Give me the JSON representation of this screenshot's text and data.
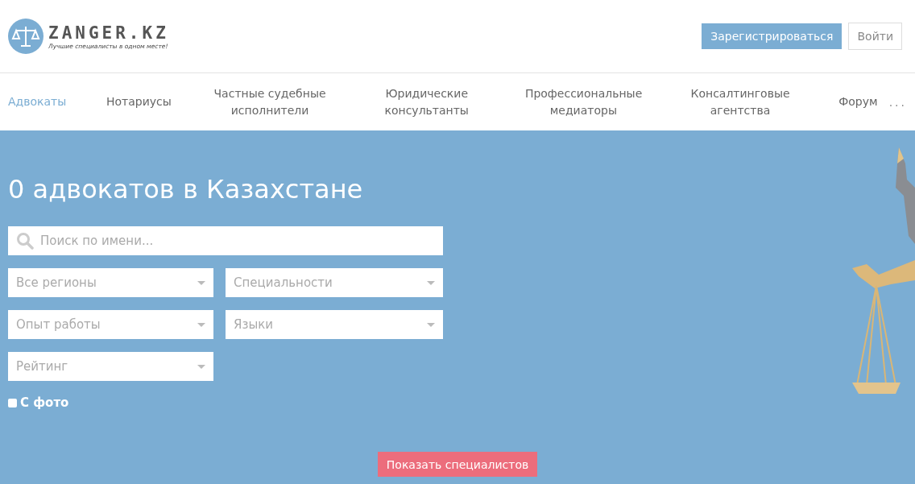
{
  "header": {
    "logo": {
      "name": "ZANGER.KZ",
      "tagline": "Лучшие специалисты в одном месте!"
    },
    "buttons": [
      {
        "label": "Зарегистрироваться",
        "kind": "primary"
      },
      {
        "label": "Войти",
        "kind": "outline"
      }
    ]
  },
  "nav": {
    "items": [
      {
        "label": "Адвокаты",
        "selected": true
      },
      {
        "label": "Нотариусы",
        "selected": false
      },
      {
        "label": "Частные судебные исполнители",
        "selected": false
      },
      {
        "label": "Юридические консультанты",
        "selected": false
      },
      {
        "label": "Профессиональные медиаторы",
        "selected": false
      },
      {
        "label": "Консалтинговые агентства",
        "selected": false
      },
      {
        "label": "Форум",
        "selected": false
      }
    ],
    "more": "..."
  },
  "hero": {
    "title": "0 адвокатов в Казахстане",
    "search": {
      "placeholder": "Поиск по имени..."
    },
    "filters": [
      {
        "placeholder": "Все регионы"
      },
      {
        "placeholder": "Специальности"
      },
      {
        "placeholder": "Опыт работы"
      },
      {
        "placeholder": "Языки"
      },
      {
        "placeholder": "Рейтинг"
      }
    ],
    "photo_filter": {
      "label": "С фото",
      "checked": false
    },
    "submit": "Показать специалистов"
  }
}
